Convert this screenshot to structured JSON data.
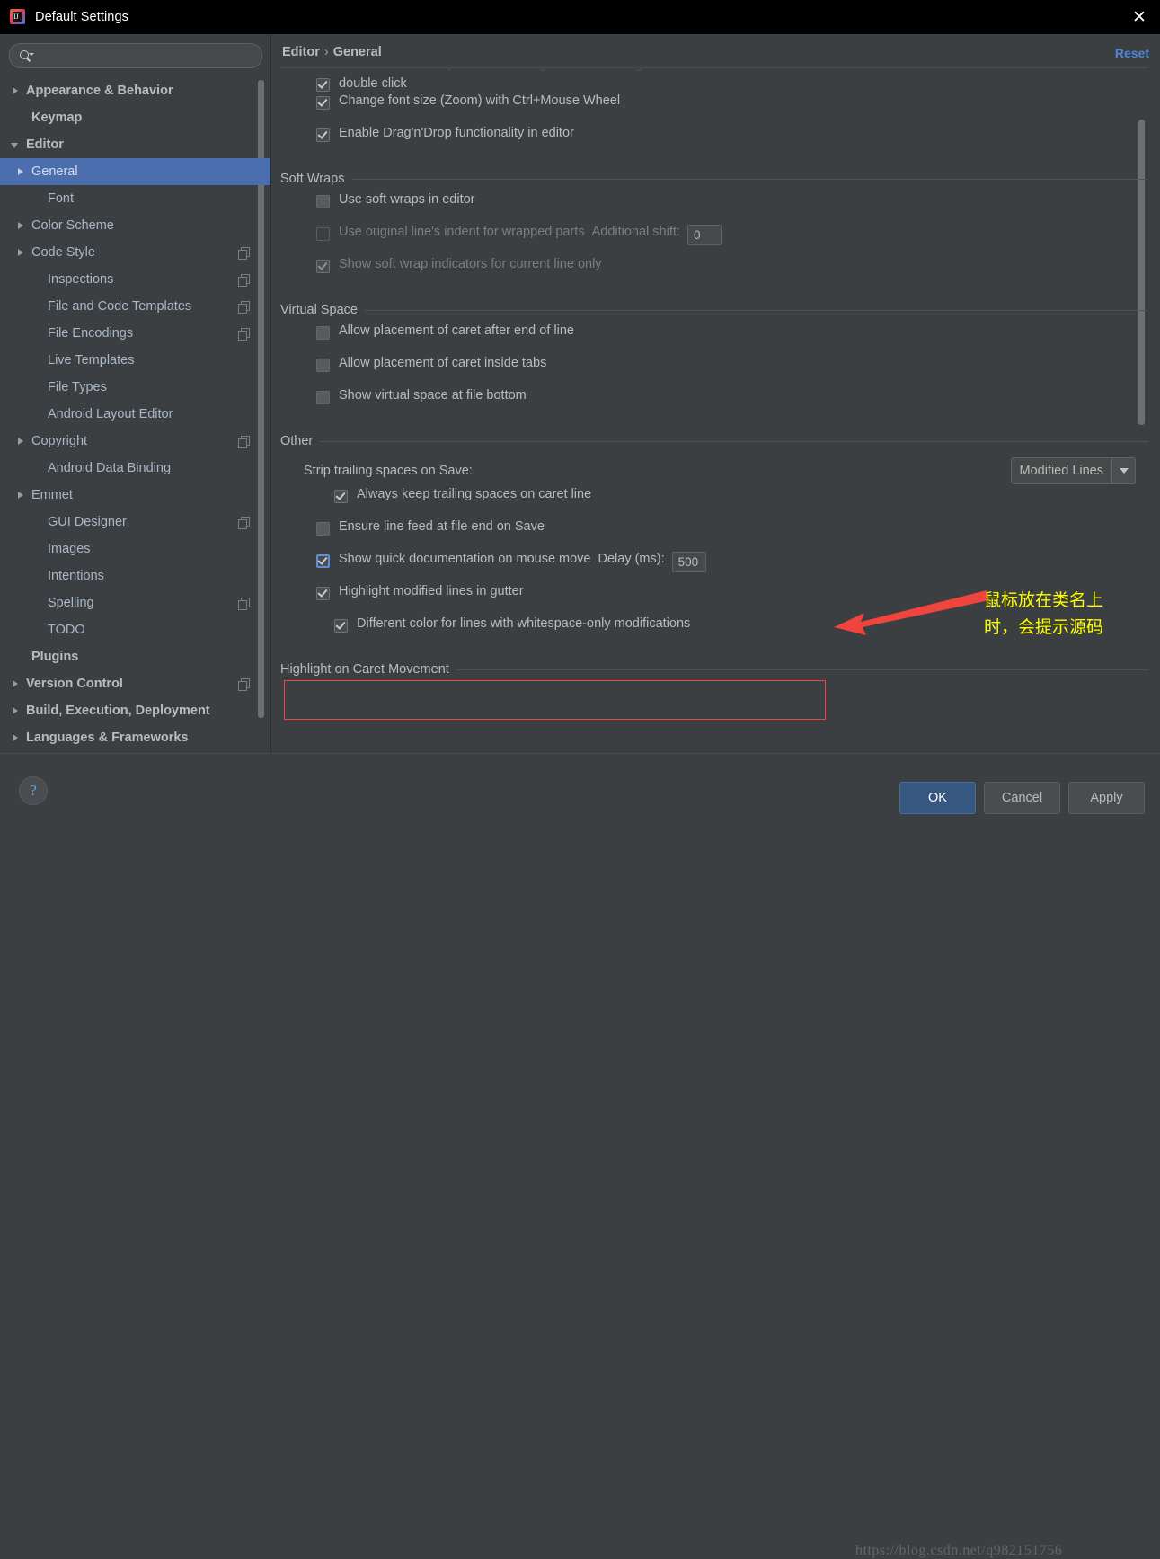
{
  "window": {
    "title": "Default Settings",
    "logo_text": "IJ",
    "close_icon": "close-icon"
  },
  "search": {
    "value": "",
    "placeholder": ""
  },
  "sidebar": {
    "items": [
      {
        "label": "Appearance & Behavior",
        "indent": 0,
        "arrow": "right",
        "bold": true,
        "copy": false,
        "selected": false
      },
      {
        "label": "Keymap",
        "indent": 1,
        "arrow": "none",
        "bold": true,
        "copy": false,
        "selected": false
      },
      {
        "label": "Editor",
        "indent": 0,
        "arrow": "down",
        "bold": true,
        "copy": false,
        "selected": false
      },
      {
        "label": "General",
        "indent": 1,
        "arrow": "right",
        "bold": false,
        "copy": false,
        "selected": true
      },
      {
        "label": "Font",
        "indent": 2,
        "arrow": "none",
        "bold": false,
        "copy": false,
        "selected": false
      },
      {
        "label": "Color Scheme",
        "indent": 1,
        "arrow": "right",
        "bold": false,
        "copy": false,
        "selected": false
      },
      {
        "label": "Code Style",
        "indent": 1,
        "arrow": "right",
        "bold": false,
        "copy": true,
        "selected": false
      },
      {
        "label": "Inspections",
        "indent": 2,
        "arrow": "none",
        "bold": false,
        "copy": true,
        "selected": false
      },
      {
        "label": "File and Code Templates",
        "indent": 2,
        "arrow": "none",
        "bold": false,
        "copy": true,
        "selected": false
      },
      {
        "label": "File Encodings",
        "indent": 2,
        "arrow": "none",
        "bold": false,
        "copy": true,
        "selected": false
      },
      {
        "label": "Live Templates",
        "indent": 2,
        "arrow": "none",
        "bold": false,
        "copy": false,
        "selected": false
      },
      {
        "label": "File Types",
        "indent": 2,
        "arrow": "none",
        "bold": false,
        "copy": false,
        "selected": false
      },
      {
        "label": "Android Layout Editor",
        "indent": 2,
        "arrow": "none",
        "bold": false,
        "copy": false,
        "selected": false
      },
      {
        "label": "Copyright",
        "indent": 1,
        "arrow": "right",
        "bold": false,
        "copy": true,
        "selected": false
      },
      {
        "label": "Android Data Binding",
        "indent": 2,
        "arrow": "none",
        "bold": false,
        "copy": false,
        "selected": false
      },
      {
        "label": "Emmet",
        "indent": 1,
        "arrow": "right",
        "bold": false,
        "copy": false,
        "selected": false
      },
      {
        "label": "GUI Designer",
        "indent": 2,
        "arrow": "none",
        "bold": false,
        "copy": true,
        "selected": false
      },
      {
        "label": "Images",
        "indent": 2,
        "arrow": "none",
        "bold": false,
        "copy": false,
        "selected": false
      },
      {
        "label": "Intentions",
        "indent": 2,
        "arrow": "none",
        "bold": false,
        "copy": false,
        "selected": false
      },
      {
        "label": "Spelling",
        "indent": 2,
        "arrow": "none",
        "bold": false,
        "copy": true,
        "selected": false
      },
      {
        "label": "TODO",
        "indent": 2,
        "arrow": "none",
        "bold": false,
        "copy": false,
        "selected": false
      },
      {
        "label": "Plugins",
        "indent": 1,
        "arrow": "none",
        "bold": true,
        "copy": false,
        "selected": false
      },
      {
        "label": "Version Control",
        "indent": 0,
        "arrow": "right",
        "bold": true,
        "copy": true,
        "selected": false
      },
      {
        "label": "Build, Execution, Deployment",
        "indent": 0,
        "arrow": "right",
        "bold": true,
        "copy": false,
        "selected": false
      },
      {
        "label": "Languages & Frameworks",
        "indent": 0,
        "arrow": "right",
        "bold": true,
        "copy": false,
        "selected": false
      }
    ]
  },
  "main": {
    "breadcrumb_root": "Editor",
    "breadcrumb_sep": "›",
    "breadcrumb_leaf": "General",
    "reset_label": "Reset",
    "top_partial": {
      "line1": "Honor \"CamelHumps\" words settings when selecting on",
      "line2": "double click"
    },
    "top_options": [
      {
        "label": "Change font size (Zoom) with Ctrl+Mouse Wheel",
        "checked": true,
        "disabled": false
      },
      {
        "label": "Enable Drag'n'Drop functionality in editor",
        "checked": true,
        "disabled": false
      }
    ],
    "groups": [
      {
        "title": "Soft Wraps",
        "options": [
          {
            "label": "Use soft wraps in editor",
            "checked": false,
            "disabled": false
          },
          {
            "label": "Use original line's indent for wrapped parts",
            "checked": false,
            "disabled": true,
            "field_label": "Additional shift:",
            "field_value": "0"
          },
          {
            "label": "Show soft wrap indicators for current line only",
            "checked": true,
            "disabled": true
          }
        ]
      },
      {
        "title": "Virtual Space",
        "options": [
          {
            "label": "Allow placement of caret after end of line",
            "checked": false,
            "disabled": false
          },
          {
            "label": "Allow placement of caret inside tabs",
            "checked": false,
            "disabled": false
          },
          {
            "label": "Show virtual space at file bottom",
            "checked": false,
            "disabled": false
          }
        ]
      }
    ],
    "other": {
      "title": "Other",
      "strip_label": "Strip trailing spaces on Save:",
      "strip_value": "Modified Lines",
      "options": [
        {
          "label": "Always keep trailing spaces on caret line",
          "checked": true,
          "disabled": false,
          "indent": 2
        },
        {
          "label": "Ensure line feed at file end on Save",
          "checked": false,
          "disabled": false,
          "indent": 1
        },
        {
          "label": "Show quick documentation on mouse move",
          "checked": true,
          "disabled": false,
          "indent": 1,
          "focused": true,
          "field_label": "Delay (ms):",
          "field_value": "500"
        },
        {
          "label": "Highlight modified lines in gutter",
          "checked": true,
          "disabled": false,
          "indent": 1
        },
        {
          "label": "Different color for lines with whitespace-only modifications",
          "checked": true,
          "disabled": false,
          "indent": 2
        }
      ]
    },
    "last_group_title": "Highlight on Caret Movement"
  },
  "annotation": {
    "text": "鼠标放在类名上\n时，会提示源码",
    "color": "#ffff00",
    "arrow_color": "#f0443e"
  },
  "footer": {
    "help_label": "?",
    "ok_label": "OK",
    "cancel_label": "Cancel",
    "apply_label": "Apply",
    "watermark": "https://blog.csdn.net/q982151756"
  },
  "colors": {
    "window_bg": "#3c3f41",
    "titlebar_bg": "#000000",
    "selection": "#4b6eaf",
    "accent_link": "#4d86d6",
    "primary_button": "#365880",
    "highlight_box": "#f0443e",
    "annotation": "#ffff00"
  }
}
